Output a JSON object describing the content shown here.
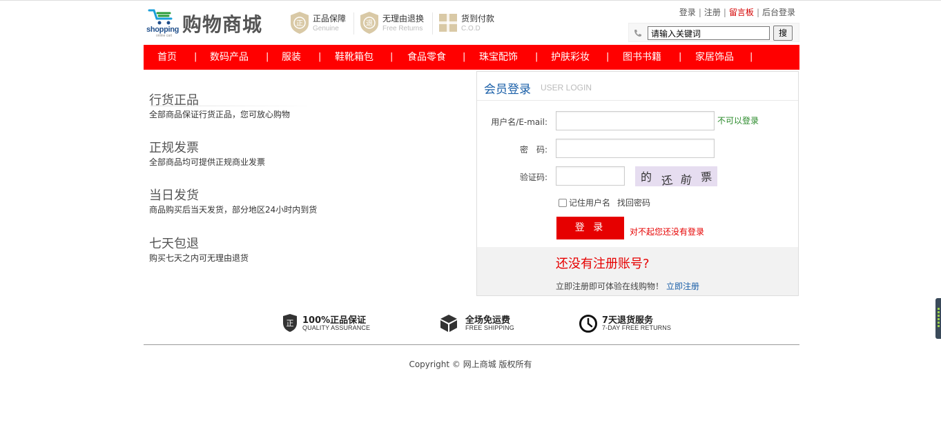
{
  "header": {
    "logo_word": "shopping",
    "logo_sub": "online cart",
    "brand": "购物商城",
    "promises": [
      {
        "title": "正品保障",
        "en": "Genuine",
        "badge_char": "正"
      },
      {
        "title": "无理由退换",
        "en": "Free Returns",
        "badge_char": "退"
      },
      {
        "title": "货到付款",
        "en": "C.O.D"
      }
    ],
    "toplinks": {
      "login": "登录",
      "register": "注册",
      "message_board": "留言板",
      "admin_login": "后台登录",
      "separator": "|"
    },
    "search": {
      "value": "请输入关键词",
      "button": "搜"
    }
  },
  "nav": {
    "items": [
      "首页",
      "数码产品",
      "服装",
      "鞋靴箱包",
      "食品零食",
      "珠宝配饰",
      "护肤彩妆",
      "图书书籍",
      "家居饰品"
    ],
    "separator": "|"
  },
  "features": [
    {
      "title": "行货正品",
      "desc": "全部商品保证行货正品，您可放心购物"
    },
    {
      "title": "正规发票",
      "desc": "全部商品均可提供正规商业发票"
    },
    {
      "title": "当日发货",
      "desc": "商品购买后当天发货，部分地区24小时内到货"
    },
    {
      "title": "七天包退",
      "desc": "购买七天之内可无理由退货"
    }
  ],
  "login": {
    "title": "会员登录",
    "subtitle": "USER LOGIN",
    "username_label": "用户名/E-mail:",
    "username_value": "",
    "username_hint": "不可以登录",
    "password_label": "密　码:",
    "password_value": "",
    "captcha_label": "验证码:",
    "captcha_value": "",
    "captcha_chars": [
      "的",
      "还",
      "前",
      "票"
    ],
    "remember_label": "记住用户名",
    "find_password": "找回密码",
    "submit": "登 录",
    "error": "对不起您还没有登录",
    "register_title": "还没有注册账号?",
    "register_text": "立即注册即可体验在线购物！",
    "register_link": "立即注册"
  },
  "services": [
    {
      "title": "100%正品保证",
      "en": "QUALITY ASSURANCE",
      "icon": "shield-icon",
      "icon_char": "正"
    },
    {
      "title": "全场免运费",
      "en": "FREE SHIPPING",
      "icon": "box-icon"
    },
    {
      "title": "7天退货服务",
      "en": "7-DAY FREE RETURNS",
      "icon": "clock-icon"
    }
  ],
  "footer": {
    "copyright": "Copyright © 网上商城 版权所有"
  },
  "colors": {
    "nav_red": "#ff0000",
    "button_red": "#e60000",
    "link_blue": "#1a5fa8",
    "hint_green": "#2a8a2a"
  }
}
